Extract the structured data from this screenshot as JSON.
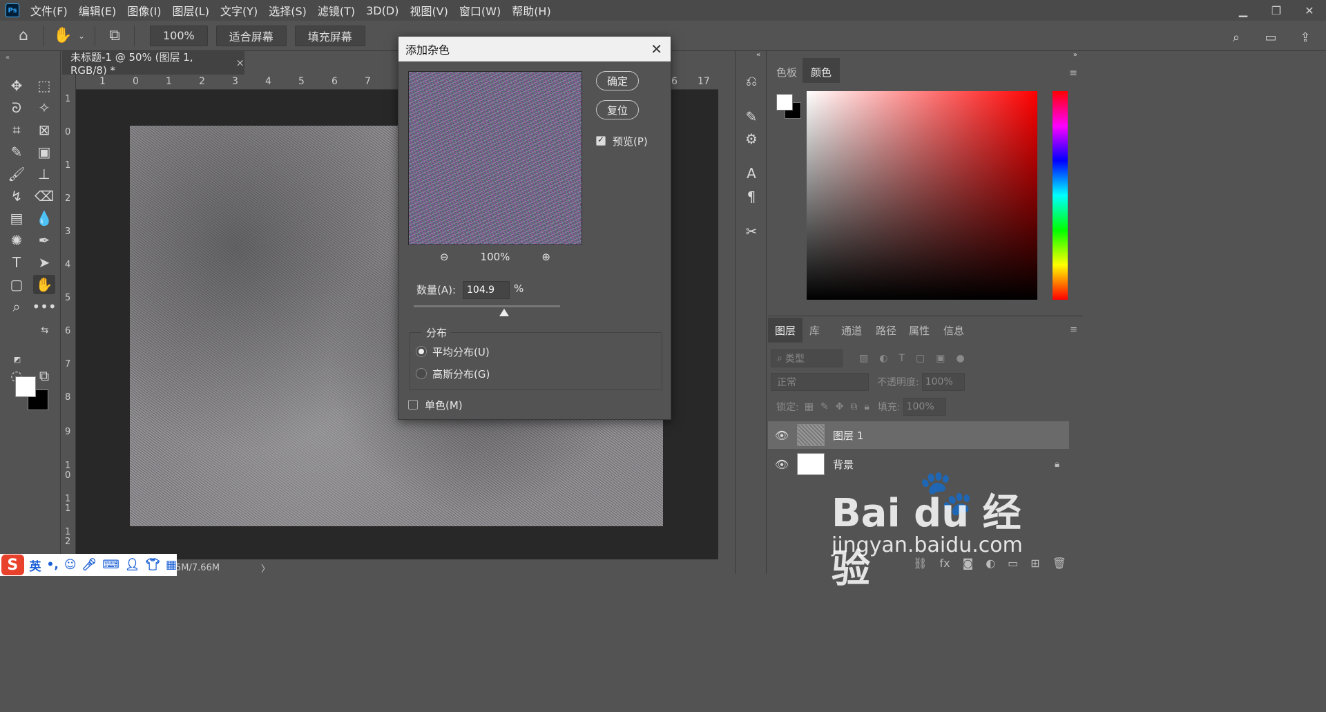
{
  "menubar": {
    "logo": "Ps",
    "items": [
      "文件(F)",
      "编辑(E)",
      "图像(I)",
      "图层(L)",
      "文字(Y)",
      "选择(S)",
      "滤镜(T)",
      "3D(D)",
      "视图(V)",
      "窗口(W)",
      "帮助(H)"
    ]
  },
  "optionsbar": {
    "zoom_label": "100%",
    "fit_screen": "适合屏幕",
    "fill_screen": "填充屏幕"
  },
  "document": {
    "tab_title": "未标题-1 @ 50% (图层 1, RGB/8) *",
    "tab_close": "×",
    "status": "5M/7.66M",
    "ruler_top": [
      "1",
      "0",
      "1",
      "2",
      "3",
      "4",
      "5",
      "6",
      "7",
      "6",
      "17"
    ],
    "ruler_left": [
      "1",
      "0",
      "1",
      "2",
      "3",
      "4",
      "5",
      "6",
      "7",
      "8",
      "9",
      "1 0",
      "1 1",
      "1 2"
    ]
  },
  "dialog": {
    "title": "添加杂色",
    "ok": "确定",
    "reset": "复位",
    "preview_label": "预览(P)",
    "preview_checked": true,
    "zoom_level": "100%",
    "amount_label": "数量(A):",
    "amount_value": "104.9",
    "amount_unit": "%",
    "distribution_title": "分布",
    "uniform_label": "平均分布(U)",
    "gaussian_label": "高斯分布(G)",
    "selected_distribution": "uniform",
    "monochrome_label": "单色(M)",
    "monochrome_checked": false
  },
  "color_panel": {
    "tab_swatches": "色板",
    "tab_color": "颜色"
  },
  "layers_panel": {
    "tabs": [
      "图层",
      "库",
      "通道",
      "路径",
      "属性",
      "信息"
    ],
    "filter_placeholder": "类型",
    "blend_mode": "正常",
    "opacity_label": "不透明度:",
    "opacity_value": "100%",
    "lock_label": "锁定:",
    "fill_label": "填充:",
    "fill_value": "100%",
    "layers": [
      {
        "name": "图层 1",
        "selected": true
      },
      {
        "name": "背景",
        "selected": false
      }
    ]
  },
  "ime": {
    "lang": "英",
    "punct": "•,"
  },
  "watermark": {
    "brand": "Bai du 经验",
    "url": "jingyan.baidu.com"
  }
}
